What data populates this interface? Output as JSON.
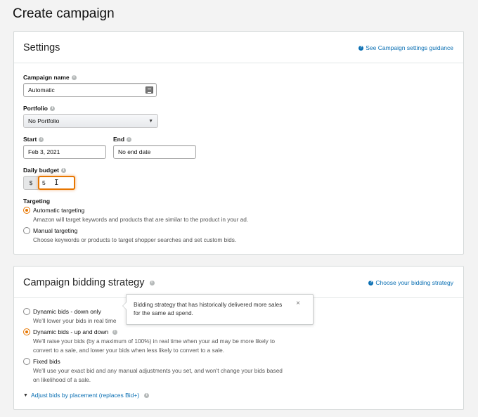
{
  "page": {
    "title": "Create campaign"
  },
  "settings": {
    "title": "Settings",
    "guidance_link": "See Campaign settings guidance",
    "campaign_name": {
      "label": "Campaign name",
      "value": "Automatic"
    },
    "portfolio": {
      "label": "Portfolio",
      "value": "No Portfolio"
    },
    "start": {
      "label": "Start",
      "value": "Feb 3, 2021"
    },
    "end": {
      "label": "End",
      "value": "No end date"
    },
    "daily_budget": {
      "label": "Daily budget",
      "currency": "$",
      "value": "5"
    },
    "targeting": {
      "label": "Targeting",
      "options": [
        {
          "title": "Automatic targeting",
          "desc": "Amazon will target keywords and products that are similar to the product in your ad.",
          "selected": true
        },
        {
          "title": "Manual targeting",
          "desc": "Choose keywords or products to target shopper searches and set custom bids.",
          "selected": false
        }
      ]
    }
  },
  "bidding": {
    "title": "Campaign bidding strategy",
    "help_link": "Choose your bidding strategy",
    "tooltip": {
      "text": "Bidding strategy that has historically delivered more sales for the same ad spend.",
      "close": "×"
    },
    "options": [
      {
        "title": "Dynamic bids - down only",
        "desc": "We'll lower your bids in real time",
        "selected": false
      },
      {
        "title": "Dynamic bids - up and down",
        "desc_line1": "We'll raise your bids (by a maximum of 100%) in real time when your ad may be more likely to",
        "desc_line2": "convert to a sale, and lower your bids when less likely to convert to a sale.",
        "selected": true
      },
      {
        "title": "Fixed bids",
        "desc_line1": "We'll use your exact bid and any manual adjustments you set, and won't change your bids based",
        "desc_line2": "on likelihood of a sale.",
        "selected": false
      }
    ],
    "adjust_link": "Adjust bids by placement (replaces Bid+)"
  },
  "icons": {
    "info": "info-icon",
    "help": "help-circle-icon",
    "chevron": "chevron-down-icon",
    "contact_card": "contact-card-icon",
    "text_cursor": "text-cursor-icon"
  },
  "colors": {
    "accent": "#e77600",
    "link": "#0a6fb3"
  }
}
